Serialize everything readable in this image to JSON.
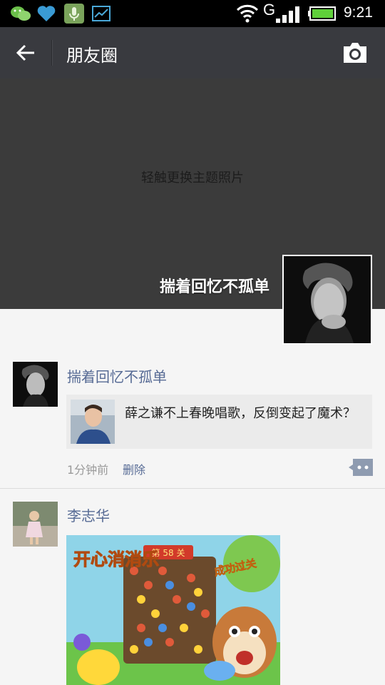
{
  "status_bar": {
    "network": "G",
    "time": "9:21",
    "icons": [
      "wechat-icon",
      "heart-icon",
      "voice-app-icon",
      "trend-icon",
      "wifi-icon",
      "signal-icon",
      "battery-icon"
    ]
  },
  "title_bar": {
    "title": "朋友圈",
    "back_icon": "back-arrow-icon",
    "camera_icon": "camera-icon"
  },
  "cover": {
    "hint": "轻触更换主题照片",
    "user_name": "揣着回忆不孤单"
  },
  "posts": [
    {
      "author": "揣着回忆不孤单",
      "shared_text": "薛之谦不上春晚唱歌，反倒变起了魔术？",
      "time": "1分钟前",
      "delete_label": "删除"
    },
    {
      "author": "李志华",
      "image_caption_title": "开心消消乐",
      "image_caption_level": "第 58 关",
      "image_caption_status": "成功过关"
    }
  ],
  "colors": {
    "title_bar": "#393a3f",
    "link_blue": "#576b95",
    "cover_bg": "#3b3b3b"
  }
}
